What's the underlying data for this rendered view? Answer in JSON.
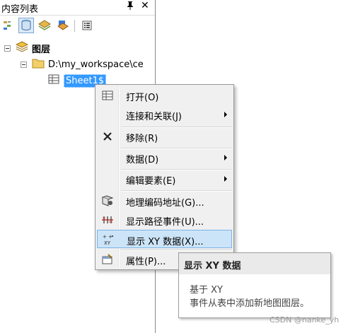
{
  "panel": {
    "title": "内容列表",
    "pin_glyph": "ᚹ",
    "close_glyph": "✕"
  },
  "toolbar": {
    "buttons": [
      {
        "icon": "list-by-drawing-order-icon"
      },
      {
        "icon": "list-by-source-icon",
        "active": true
      },
      {
        "icon": "list-by-visibility-icon"
      },
      {
        "icon": "list-by-selection-icon"
      },
      {
        "icon": "options-icon"
      }
    ]
  },
  "tree": {
    "layers_label": "图层",
    "folder_path": "D:\\my_workspace\\ce",
    "table_name": "Sheet1$"
  },
  "context_menu": {
    "items": [
      {
        "label": "打开(O)",
        "icon": "table-open-icon"
      },
      {
        "label": "连接和关联(J)",
        "submenu": true
      },
      {
        "label": "移除(R)",
        "icon": "remove-icon"
      },
      {
        "label": "数据(D)",
        "submenu": true
      },
      {
        "label": "编辑要素(E)",
        "submenu": true
      },
      {
        "label": "地理编码地址(G)...",
        "icon": "geocode-icon"
      },
      {
        "label": "显示路径事件(U)...",
        "icon": "route-events-icon"
      },
      {
        "label": "显示 XY 数据(X)...",
        "icon": "xy-data-icon",
        "highlighted": true
      },
      {
        "label": "属性(P)...",
        "icon": "properties-icon"
      }
    ]
  },
  "tooltip": {
    "title": "显示 XY 数据",
    "line1": "基于 XY",
    "line2": "事件从表中添加新地图图层。"
  },
  "watermark": "CSDN @nanke_yh",
  "colors": {
    "selection": "#3399ff",
    "menu_bg": "#f0f0f0",
    "menu_hover": "#cce4f7"
  }
}
